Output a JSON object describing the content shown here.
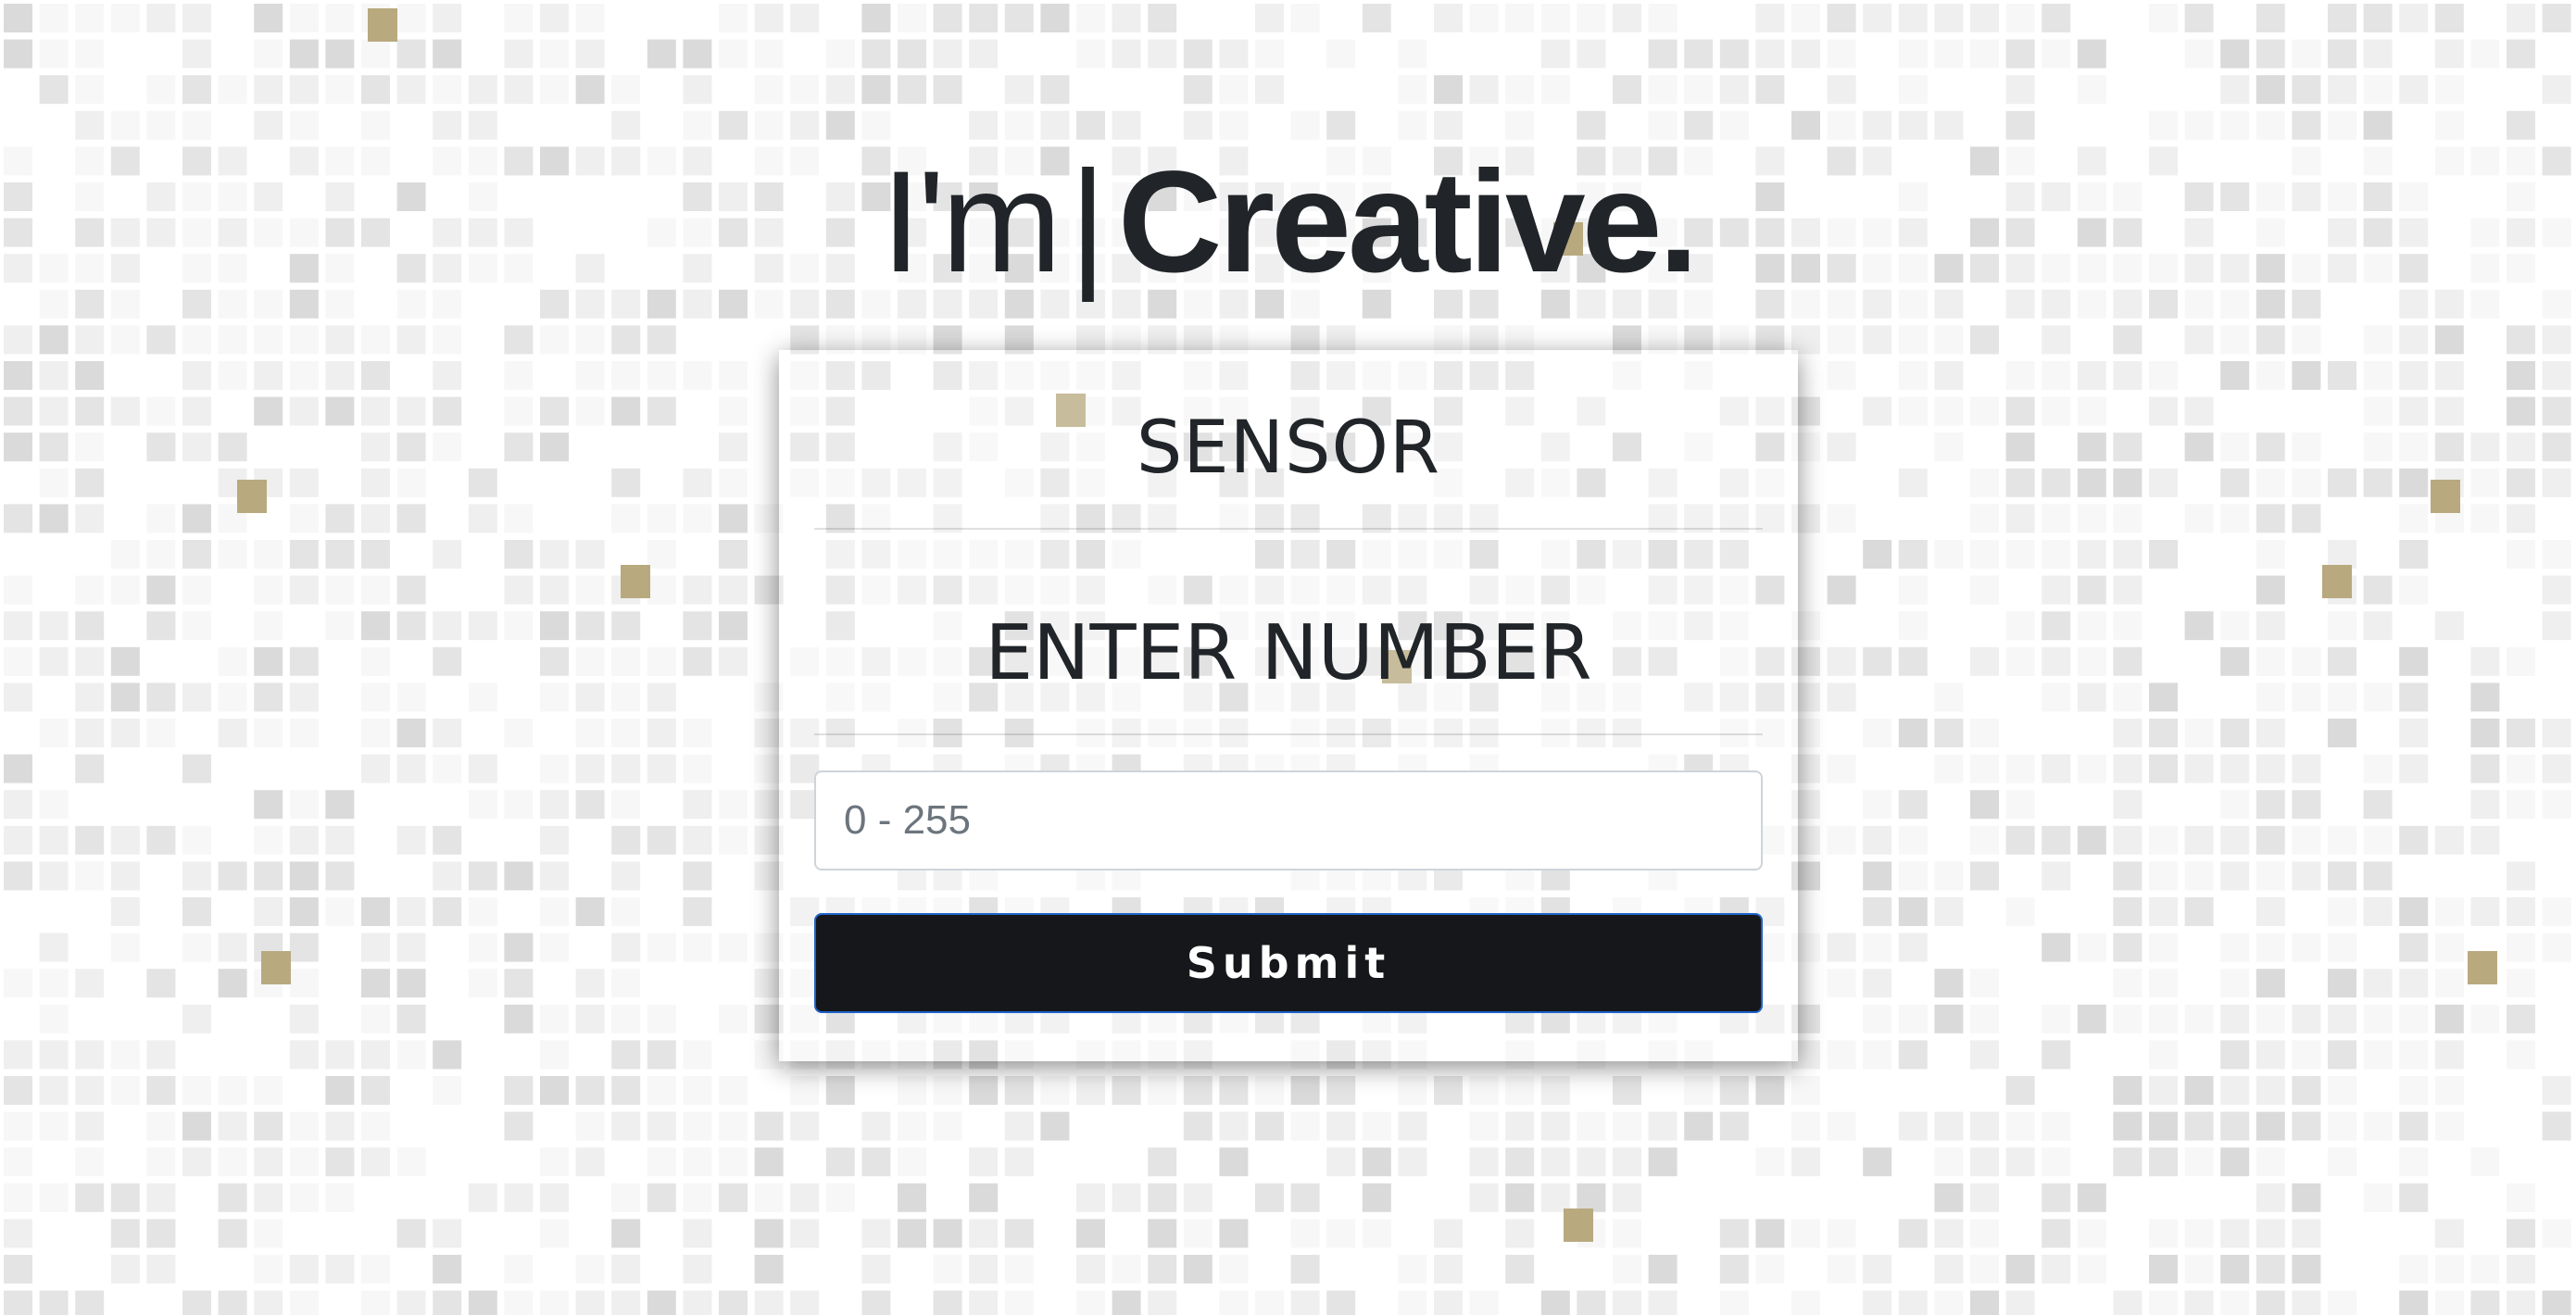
{
  "hero": {
    "prefix": "I'm",
    "separator": "|",
    "highlight": "Creative."
  },
  "card": {
    "title": "SENSOR",
    "subtitle": "ENTER NUMBER",
    "input": {
      "value": "",
      "placeholder": "0 - 255"
    },
    "submit_label": "Submit"
  },
  "background": {
    "pattern": "mosaic-tiles",
    "tile_colors": [
      "#f7f7f7",
      "#efefef",
      "#e4e4e4",
      "#dadada",
      "#b8a97f"
    ],
    "accent_color": "#b8a97f"
  }
}
